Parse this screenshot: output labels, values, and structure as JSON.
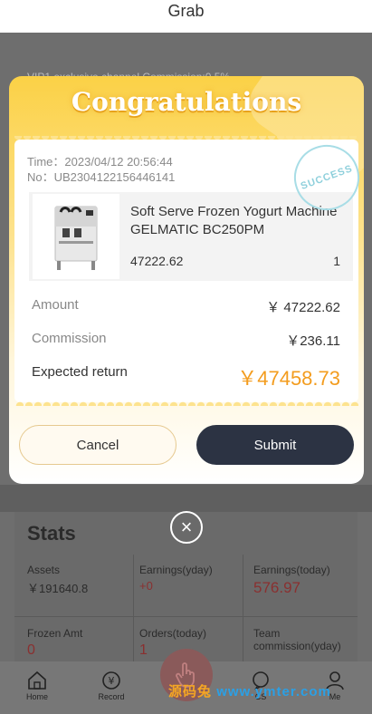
{
  "header": {
    "title": "Grab"
  },
  "background": {
    "notice": "VIP1 exclusive channel Commission:0.5%",
    "stats": {
      "title": "Stats",
      "items": [
        {
          "label": "Assets",
          "value": "￥191640.8"
        },
        {
          "label": "Earnings(yday)",
          "value": "+0"
        },
        {
          "label": "Earnings(today)",
          "value": "576.97"
        },
        {
          "label": "Frozen Amt",
          "value": "0"
        },
        {
          "label": "Orders(today)",
          "value": "1"
        },
        {
          "label": "Team commission(yday)",
          "value": ""
        }
      ]
    }
  },
  "tabbar": {
    "items": [
      {
        "label": "Home",
        "icon": "home-icon"
      },
      {
        "label": "Record",
        "icon": "record-icon"
      },
      {
        "label": "CS",
        "icon": "chat-icon"
      },
      {
        "label": "Me",
        "icon": "user-icon"
      }
    ],
    "center_icon": "hand-icon"
  },
  "watermark": {
    "part1": "源码兔",
    "part2": "www.ymter.com"
  },
  "modal": {
    "title": "Congratulations",
    "stamp": "SUCCESS",
    "time": "Time：2023/04/12 20:56:44",
    "order_no": "No：UB2304122156446141",
    "product": {
      "name": "Soft Serve Frozen Yogurt Machine GELMATIC BC250PM",
      "price": "47222.62",
      "quantity": "1"
    },
    "amount_label": "Amount",
    "amount_value": "￥ 47222.62",
    "commission_label": "Commission",
    "commission_value": "￥236.11",
    "expected_label": "Expected return",
    "expected_value": "￥47458.73",
    "cancel_label": "Cancel",
    "submit_label": "Submit"
  },
  "close_icon": "close-icon",
  "colors": {
    "accent": "#f39c1e",
    "submit_bg": "#2c3343",
    "modal_top": "#fbd146"
  }
}
